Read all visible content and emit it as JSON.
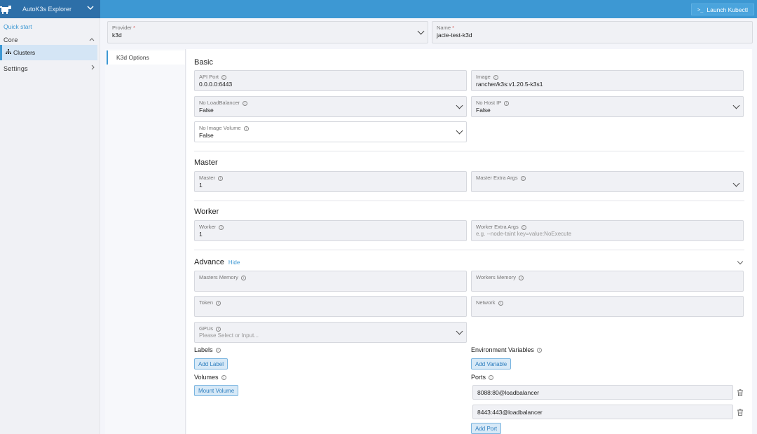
{
  "app": {
    "title": "AutoK3s Explorer",
    "launch_label": "Launch Kubectl",
    "launch_prompt": ">_"
  },
  "sidebar": {
    "quick_start": "Quick start",
    "groups": [
      {
        "label": "Core",
        "arrow": "^"
      },
      {
        "label": "Settings",
        "arrow": ">"
      }
    ],
    "items": [
      {
        "label": "Clusters",
        "icon": "cluster-icon",
        "active": true
      }
    ]
  },
  "header": {
    "provider": {
      "label": "Provider",
      "required_mark": "*",
      "value": "k3d"
    },
    "name": {
      "label": "Name",
      "required_mark": "*",
      "value": "jacie-test-k3d"
    }
  },
  "tabs": [
    {
      "label": "K3d Options",
      "active": true
    }
  ],
  "sections": {
    "basic": {
      "title": "Basic",
      "api_port": {
        "label": "API Port",
        "value": "0.0.0.0:6443"
      },
      "image": {
        "label": "Image",
        "value": "rancher/k3s:v1.20.5-k3s1"
      },
      "no_loadbalancer": {
        "label": "No LoadBalancer",
        "value": "False"
      },
      "no_host_ip": {
        "label": "No Host IP",
        "value": "False"
      },
      "no_image_volume": {
        "label": "No Image Volume",
        "value": "False"
      }
    },
    "master": {
      "title": "Master",
      "master": {
        "label": "Master",
        "value": "1"
      },
      "master_extra_args": {
        "label": "Master Extra Args",
        "value": ""
      }
    },
    "worker": {
      "title": "Worker",
      "worker": {
        "label": "Worker",
        "value": "1"
      },
      "worker_extra_args": {
        "label": "Worker Extra Args",
        "placeholder": "e.g. --node-taint key=value:NoExecute"
      }
    },
    "advance": {
      "title": "Advance",
      "toggle_label": "Hide",
      "masters_memory": {
        "label": "Masters Memory"
      },
      "workers_memory": {
        "label": "Workers Memory"
      },
      "token": {
        "label": "Token"
      },
      "network": {
        "label": "Network"
      },
      "gpus": {
        "label": "GPUs",
        "placeholder": "Please Select or Input..."
      },
      "labels": {
        "label": "Labels",
        "button": "Add Label"
      },
      "env_vars": {
        "label": "Environment Variables",
        "button": "Add Variable"
      },
      "volumes": {
        "label": "Volumes",
        "button": "Mount Volume"
      },
      "ports": {
        "label": "Ports",
        "items": [
          "8088:80@loadbalancer",
          "8443:443@loadbalancer"
        ],
        "button": "Add Port"
      }
    }
  },
  "colors": {
    "accent": "#3d98d3",
    "brand_bg": "#2d6fa8",
    "topbar": "#3d98d3",
    "required": "#d9534f"
  }
}
